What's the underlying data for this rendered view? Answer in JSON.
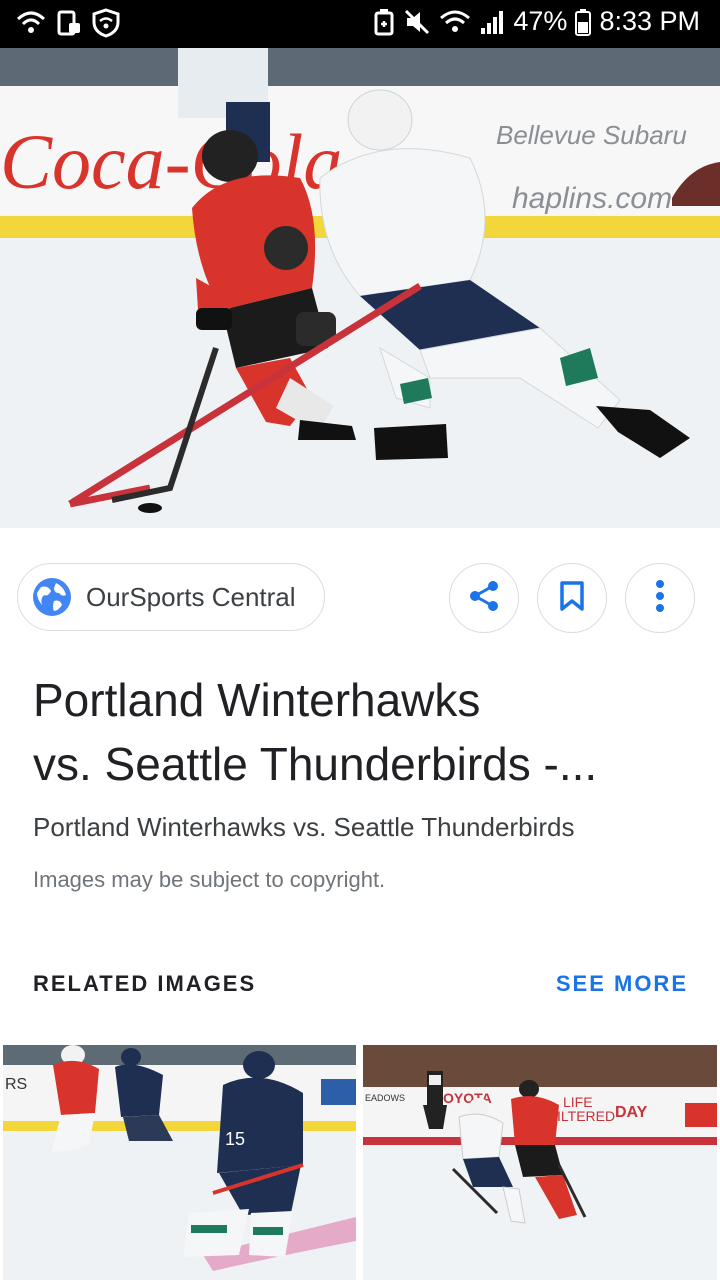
{
  "status_bar": {
    "battery": "47%",
    "time": "8:33 PM"
  },
  "hero": {
    "ad_text_left": "Coca-Cola",
    "ad_text_right_1": "Bellevue Subaru",
    "ad_text_right_2": "haplins.com"
  },
  "source": {
    "name": "OurSports Central",
    "icon": "globe-icon"
  },
  "actions": {
    "share_icon": "share-icon",
    "save_icon": "bookmark-icon",
    "more_icon": "more-vert-icon"
  },
  "result": {
    "title_line1": "Portland Winterhawks",
    "title_line2": "vs. Seattle Thunderbirds -...",
    "subtitle": "Portland Winterhawks vs. Seattle Thunderbirds",
    "copyright": "Images may be subject to copyright."
  },
  "related": {
    "label": "RELATED IMAGES",
    "see_more": "SEE MORE",
    "thumb1_text": "RS",
    "thumb2_texts": [
      "EADOWS",
      "OYOTA",
      "LIFE",
      "ILTERED",
      "DAY"
    ]
  },
  "colors": {
    "accent": "#1a73e8",
    "winterhawks_red": "#d9342b",
    "thunderbirds_navy": "#1f2f52",
    "thunderbirds_green": "#1e7a5a"
  }
}
